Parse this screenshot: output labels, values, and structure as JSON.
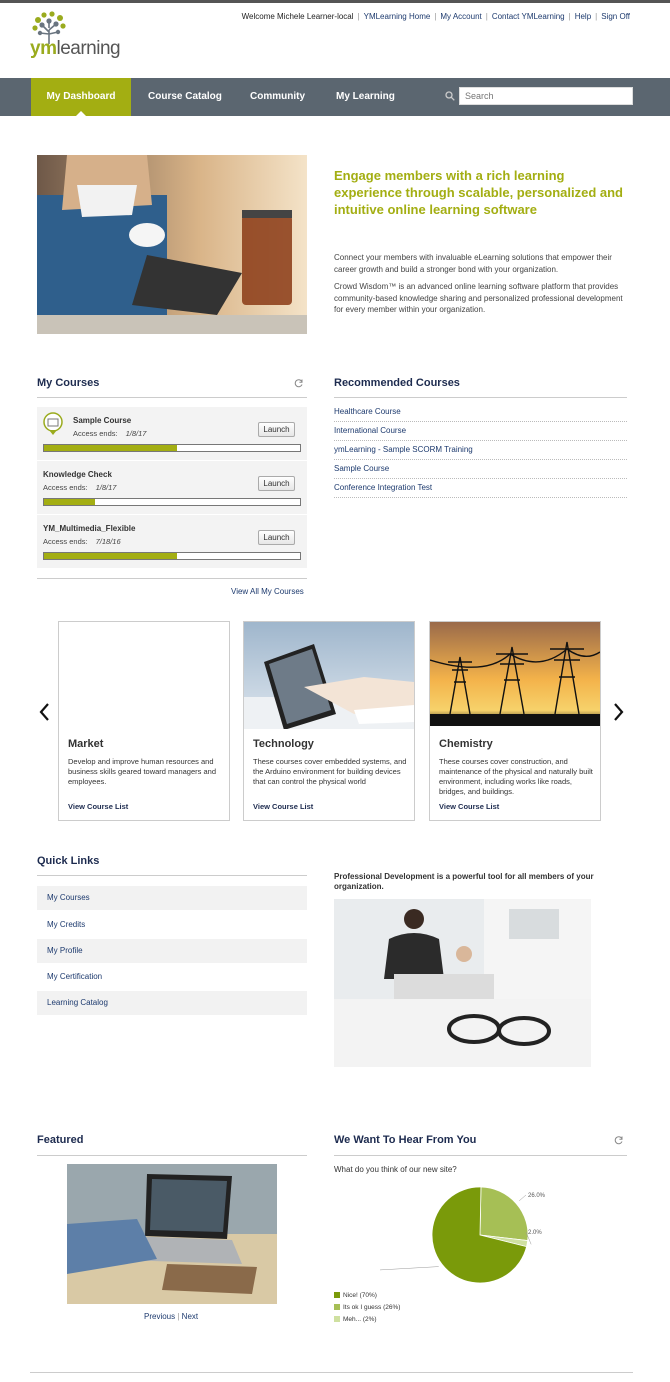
{
  "brand": {
    "logo_y": "ym",
    "logo_rest": "learning",
    "accent": "#a3ae12",
    "nav_bg": "#5b6670",
    "link_color": "#1d3a6e"
  },
  "topnav": {
    "welcome": "Welcome  Michele Learner-local",
    "links": [
      "YMLearning Home",
      "My Account",
      "Contact YMLearning",
      "Help",
      "Sign Off"
    ]
  },
  "mainnav": {
    "items": [
      "My Dashboard",
      "Course Catalog",
      "Community",
      "My Learning"
    ],
    "active": "My Dashboard",
    "search_placeholder": "Search"
  },
  "hero": {
    "title": "Engage members with a rich learning experience through scalable, personalized and intuitive online learning software",
    "p1": "Connect your members with invaluable eLearning solutions that empower their career growth and build a stronger bond with your organization.",
    "p2": "Crowd Wisdom™ is an advanced online learning software platform that provides community-based knowledge sharing and personalized professional development for every member within your organization."
  },
  "my_courses": {
    "title": "My Courses",
    "access_label": "Access ends:",
    "launch_label": "Launch",
    "courses": [
      {
        "name": "Sample Course",
        "date": "1/8/17",
        "progress": 0.52
      },
      {
        "name": "Knowledge Check",
        "date": "1/8/17",
        "progress": 0.2
      },
      {
        "name": "YM_Multimedia_Flexible",
        "date": "7/18/16",
        "progress": 0.52
      }
    ],
    "view_all": "View All My Courses"
  },
  "recommended": {
    "title": "Recommended Courses",
    "items": [
      "Healthcare Course",
      "International Course",
      "ymLearning - Sample SCORM Training",
      "Sample Course",
      "Conference Integration Test"
    ]
  },
  "categories": [
    {
      "title": "Market",
      "desc": "Develop and improve human resources and business skills geared toward managers and employees.",
      "link": "View Course List"
    },
    {
      "title": "Technology",
      "desc": "These courses cover embedded systems, and the Arduino environment for building devices that can control the physical world",
      "link": "View Course List"
    },
    {
      "title": "Chemistry",
      "desc": "These courses cover construction, and maintenance of the physical and naturally built environment, including works like roads, bridges, and buildings.",
      "link": "View Course List"
    }
  ],
  "quick_links": {
    "title": "Quick Links",
    "items": [
      "My Courses",
      "My Credits",
      "My Profile",
      "My Certification",
      "Learning Catalog"
    ]
  },
  "pd": {
    "text": "Professional Development is a powerful tool for all members of your organization."
  },
  "featured": {
    "title": "Featured",
    "prev": "Previous",
    "sep": "|",
    "next": "Next"
  },
  "poll": {
    "title": "We Want To Hear From You",
    "question": "What do you think of our new site?",
    "legend": [
      "Nice!  (70%)",
      "Its ok I guess  (26%)",
      "Meh...  (2%)"
    ]
  },
  "chart_data": {
    "type": "pie",
    "categories": [
      "Nice!",
      "Its ok I guess",
      "Meh..."
    ],
    "values": [
      70.0,
      26.0,
      2.0
    ],
    "labels": [
      "70.0%",
      "26.0%",
      "2.0%"
    ],
    "colors": [
      "#7a9a0a",
      "#a6bf55",
      "#cfe0a0"
    ],
    "legend_position": "bottom-left"
  }
}
